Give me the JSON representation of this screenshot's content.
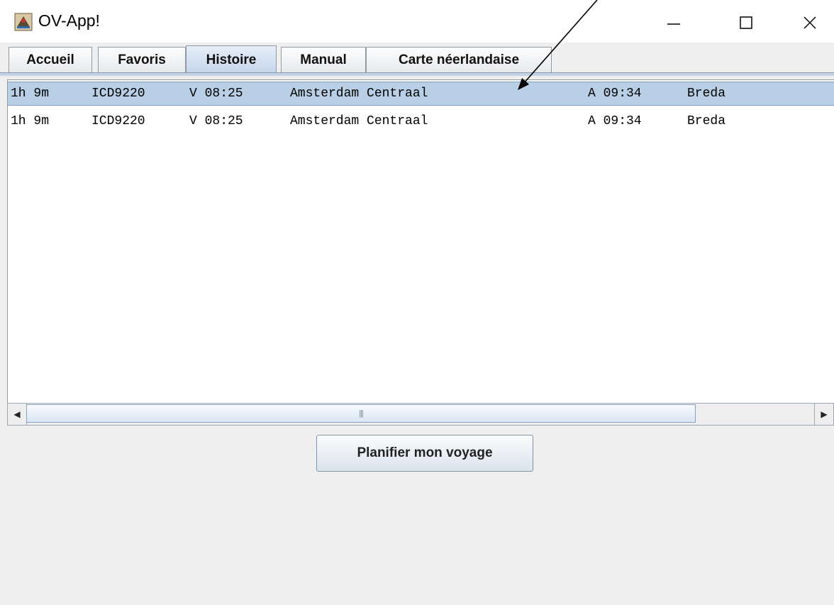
{
  "window": {
    "title": "OV-App!",
    "controls": {
      "minimize": "–",
      "maximize": "☐",
      "close": "✕"
    }
  },
  "tabs": [
    {
      "label": "Accueil",
      "selected": false
    },
    {
      "label": "Favoris",
      "selected": false
    },
    {
      "label": "Histoire",
      "selected": true
    },
    {
      "label": "Manual",
      "selected": false
    },
    {
      "label": "Carte néerlandaise",
      "selected": false
    }
  ],
  "history": {
    "rows": [
      {
        "duration": "1h 9m",
        "train": "ICD9220",
        "departure": "V 08:25",
        "from": "Amsterdam Centraal",
        "arrival": "A 09:34",
        "to": "Breda",
        "selected": true
      },
      {
        "duration": "1h 9m",
        "train": "ICD9220",
        "departure": "V 08:25",
        "from": "Amsterdam Centraal",
        "arrival": "A 09:34",
        "to": "Breda",
        "selected": false
      }
    ]
  },
  "scrollbar": {
    "left_arrow": "◀",
    "right_arrow": "▶",
    "grip": "|||"
  },
  "actions": {
    "plan_button": "Planifier mon voyage"
  },
  "colors": {
    "selection": "#b8cfe5",
    "tab_selected": "#c4d5ea",
    "background": "#efefef"
  },
  "icons": {
    "app": "app-icon",
    "annotation": "arrow-annotation"
  }
}
